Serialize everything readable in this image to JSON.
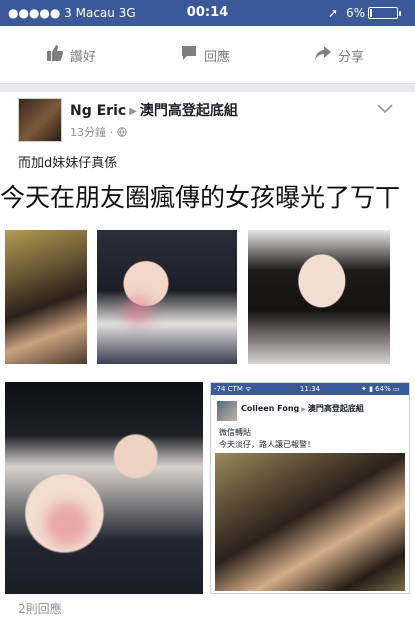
{
  "status_bar": {
    "carrier": "●●●●● 3 Macau   3G",
    "time": "00:14",
    "location_icon": "location-arrow-icon",
    "battery_percent": 6,
    "battery_text": "6%"
  },
  "prev_post_actions": [
    {
      "label": "讚好",
      "icon": "thumbs-up-icon"
    },
    {
      "label": "回應",
      "icon": "comment-icon"
    },
    {
      "label": "分享",
      "icon": "share-icon"
    }
  ],
  "post": {
    "author": "Ng Eric",
    "group": "澳門高登起底組",
    "time": "13分鐘 · ",
    "privacy_icon": "globe-icon",
    "menu_icon": "chevron-down-icon",
    "caption": "而加d妹妹仔真係",
    "headline": "今天在朋友圈瘋傳的女孩曝光了丂丅",
    "comments_count": "2則回應"
  },
  "embedded_screenshot": {
    "status_left": "-74 CTM ᯤ",
    "status_time": "11:34",
    "status_right": "✦ ▮ 64% ▭",
    "author": "Colleen Fong",
    "group": "澳門高登起底組",
    "line1": "微信轉貼",
    "line2": "今天淡仔，路人讓已報警！"
  },
  "colors": {
    "facebook_blue": "#3b5998",
    "background": "#e9ebee",
    "meta_gray": "#90949c"
  }
}
